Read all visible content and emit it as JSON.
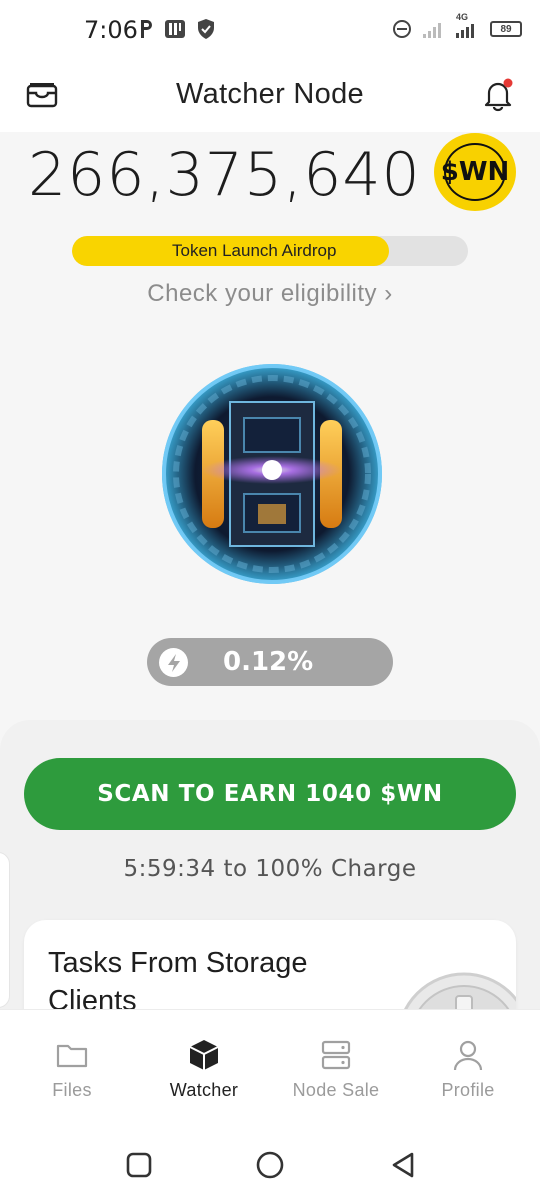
{
  "status_bar": {
    "time": "7:06",
    "battery": "89",
    "network": "4G",
    "icons": [
      "p-icon",
      "parking-icon",
      "shield-icon",
      "dnd-icon",
      "signal-icon",
      "signal-4g-icon",
      "battery-icon"
    ]
  },
  "app_bar": {
    "title": "Watcher Node",
    "left_icon": "wallet-icon",
    "right_icon": "bell-icon",
    "notification_dot_color": "#e53935"
  },
  "balance": {
    "amount": "266,375,640",
    "token": "$WN",
    "token_color": "#f8d100"
  },
  "airdrop": {
    "label": "Token Launch Airdrop",
    "progress": 0.8,
    "link": "Check your eligibility",
    "link_chevron": "›"
  },
  "charge": {
    "percent_text": "0.12%",
    "icon": "lightning-icon"
  },
  "scan_button": {
    "label": "SCAN TO EARN 1040 $WN",
    "color": "#2e9b3d"
  },
  "countdown": "5:59:34 to 100% Charge",
  "tasks_card": {
    "title": "Tasks From Storage Clients"
  },
  "bottom_nav": {
    "items": [
      {
        "label": "Files",
        "icon": "folder-icon",
        "active": false
      },
      {
        "label": "Watcher",
        "icon": "cube-icon",
        "active": true
      },
      {
        "label": "Node Sale",
        "icon": "server-icon",
        "active": false
      },
      {
        "label": "Profile",
        "icon": "user-icon",
        "active": false
      }
    ]
  },
  "system_nav": {
    "icons": [
      "recents-icon",
      "home-icon",
      "back-icon"
    ]
  }
}
